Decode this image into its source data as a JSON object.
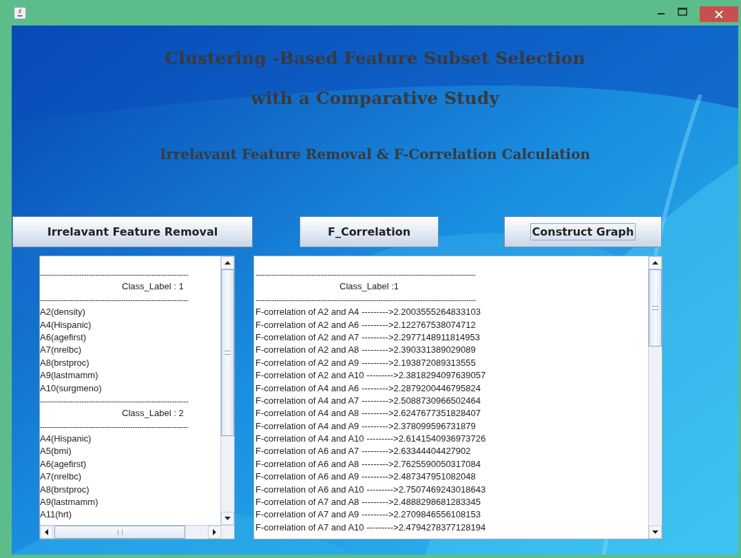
{
  "titles": [
    "Clustering -Based Feature Subset Selection",
    "with a Comparative Study"
  ],
  "subtitle": "Irrelavant Feature Removal & F-Correlation Calculation",
  "buttons": [
    {
      "label": "Irrelavant Feature Removal",
      "focused": false
    },
    {
      "label": "F_Correlation",
      "focused": false
    },
    {
      "label": "Construct Graph",
      "focused": true
    }
  ],
  "feature_list": {
    "lines": [
      {
        "kind": "rule",
        "text": "----------------------------------------------------------------"
      },
      {
        "kind": "heading",
        "text": "Class_Label : 1"
      },
      {
        "kind": "rule",
        "text": "----------------------------------------------------------------"
      },
      {
        "kind": "item",
        "text": "A2(density)"
      },
      {
        "kind": "item",
        "text": "A4(Hispanic)"
      },
      {
        "kind": "item",
        "text": "A6(agefirst)"
      },
      {
        "kind": "item",
        "text": "A7(nrelbc)"
      },
      {
        "kind": "item",
        "text": "A8(brstproc)"
      },
      {
        "kind": "item",
        "text": "A9(lastmamm)"
      },
      {
        "kind": "item",
        "text": "A10(surgmeno)"
      },
      {
        "kind": "rule",
        "text": "----------------------------------------------------------------"
      },
      {
        "kind": "heading",
        "text": "Class_Label : 2"
      },
      {
        "kind": "rule",
        "text": "----------------------------------------------------------------"
      },
      {
        "kind": "item",
        "text": "A4(Hispanic)"
      },
      {
        "kind": "item",
        "text": "A5(bmi)"
      },
      {
        "kind": "item",
        "text": "A6(agefirst)"
      },
      {
        "kind": "item",
        "text": "A7(nrelbc)"
      },
      {
        "kind": "item",
        "text": "A8(brstproc)"
      },
      {
        "kind": "item",
        "text": "A9(lastmamm)"
      },
      {
        "kind": "item",
        "text": "A11(hrt)"
      }
    ]
  },
  "correlation_list": {
    "lines": [
      {
        "kind": "rule",
        "text": "-----------------------------------------------------------------------------------------------"
      },
      {
        "kind": "heading",
        "text": "Class_Label :1"
      },
      {
        "kind": "rule",
        "text": "-----------------------------------------------------------------------------------------------"
      },
      {
        "kind": "item",
        "text": "F-correlation of A2 and A4 --------->2.2003555264833103"
      },
      {
        "kind": "item",
        "text": "F-correlation of A2 and A6 --------->2.122767538074712"
      },
      {
        "kind": "item",
        "text": "F-correlation of A2 and A7 --------->2.2977148911814953"
      },
      {
        "kind": "item",
        "text": "F-correlation of A2 and A8 --------->2.390331389029089"
      },
      {
        "kind": "item",
        "text": "F-correlation of A2 and A9 --------->2.193872089313555"
      },
      {
        "kind": "item",
        "text": "F-correlation of A2 and A10 --------->2.3818294097639057"
      },
      {
        "kind": "item",
        "text": "F-correlation of A4 and A6 --------->2.2879200446795824"
      },
      {
        "kind": "item",
        "text": "F-correlation of A4 and A7 --------->2.5088730966502464"
      },
      {
        "kind": "item",
        "text": "F-correlation of A4 and A8 --------->2.6247677351828407"
      },
      {
        "kind": "item",
        "text": "F-correlation of A4 and A9 --------->2.378099596731879"
      },
      {
        "kind": "item",
        "text": "F-correlation of A4 and A10 --------->2.6141540936973726"
      },
      {
        "kind": "item",
        "text": "F-correlation of A6 and A7 --------->2.63344404427902"
      },
      {
        "kind": "item",
        "text": "F-correlation of A6 and A8 --------->2.7625590050317084"
      },
      {
        "kind": "item",
        "text": "F-correlation of A6 and A9 --------->2.487347951082048"
      },
      {
        "kind": "item",
        "text": "F-correlation of A6 and A10 --------->2.7507469243018643"
      },
      {
        "kind": "item",
        "text": "F-correlation of A7 and A8 --------->2.4888298681283345"
      },
      {
        "kind": "item",
        "text": "F-correlation of A7 and A9 --------->2.2709846556108153"
      },
      {
        "kind": "item",
        "text": "F-correlation of A7 and A10 --------->2.4794278377128194"
      }
    ]
  }
}
